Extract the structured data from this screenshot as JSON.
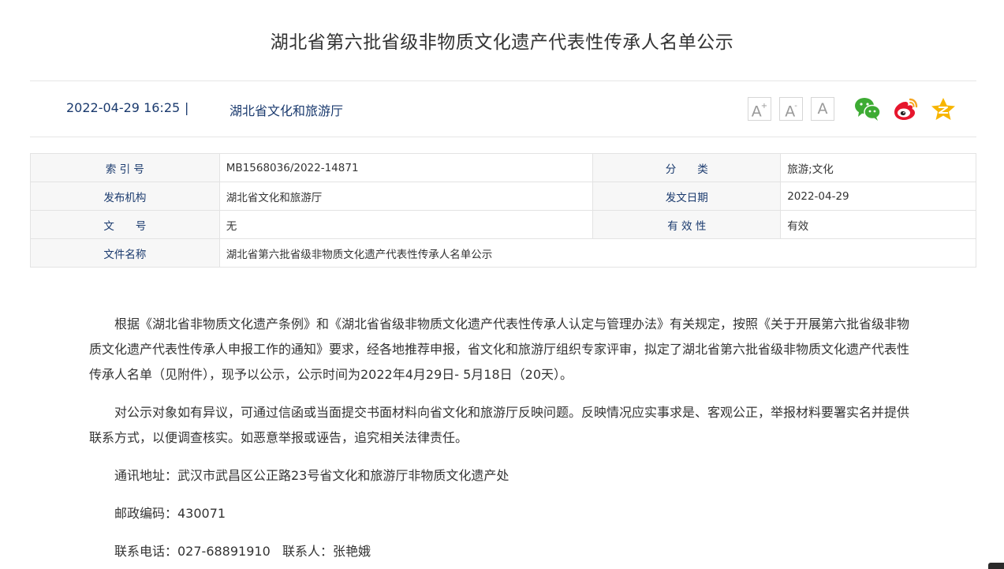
{
  "article": {
    "title": "湖北省第六批省级非物质文化遗产代表性传承人名单公示",
    "date": "2022-04-29 16:25",
    "separator": "|",
    "source": "湖北省文化和旅游厅"
  },
  "font_controls": {
    "increase_label": "A",
    "increase_sup": "+",
    "decrease_label": "A",
    "decrease_sup": "-",
    "default_label": "A"
  },
  "share": {
    "icons": [
      "wechat-icon",
      "weibo-icon",
      "qzone-icon"
    ],
    "colors": {
      "wechat": "#3dab33",
      "weibo": "#e6162d",
      "weibo_accent": "#f5a623",
      "qzone": "#f7b500"
    }
  },
  "info_table": {
    "index_label": "索 引 号",
    "index_value": "MB1568036/2022-14871",
    "category_label": "分　　类",
    "category_value": "旅游;文化",
    "publisher_label": "发布机构",
    "publisher_value": "湖北省文化和旅游厅",
    "issue_date_label": "发文日期",
    "issue_date_value": "2022-04-29",
    "doc_no_label": "文　　号",
    "doc_no_value": "无",
    "validity_label": "有 效 性",
    "validity_value": "有效",
    "filename_label": "文件名称",
    "filename_value": "湖北省第六批省级非物质文化遗产代表性传承人名单公示"
  },
  "body": {
    "paragraphs": [
      "根据《湖北省非物质文化遗产条例》和《湖北省省级非物质文化遗产代表性传承人认定与管理办法》有关规定，按照《关于开展第六批省级非物质文化遗产代表性传承人申报工作的通知》要求，经各地推荐申报，省文化和旅游厅组织专家评审，拟定了湖北省第六批省级非物质文化遗产代表性传承人名单（见附件），现予以公示，公示时间为2022年4月29日- 5月18日（20天）。",
      "对公示对象如有异议，可通过信函或当面提交书面材料向省文化和旅游厅反映问题。反映情况应实事求是、客观公正，举报材料要署实名并提供联系方式，以便调查核实。如恶意举报或诬告，追究相关法律责任。",
      "通讯地址：武汉市武昌区公正路23号省文化和旅游厅非物质文化遗产处",
      "邮政编码：430071",
      "联系电话：027-68891910   联系人：张艳娥"
    ]
  },
  "theme": {
    "title_color": "#333333",
    "meta_color": "#1a3a6e",
    "label_color": "#1a3a6e",
    "table_border": "#e3e3e3",
    "label_bg": "#f7f7f7"
  }
}
